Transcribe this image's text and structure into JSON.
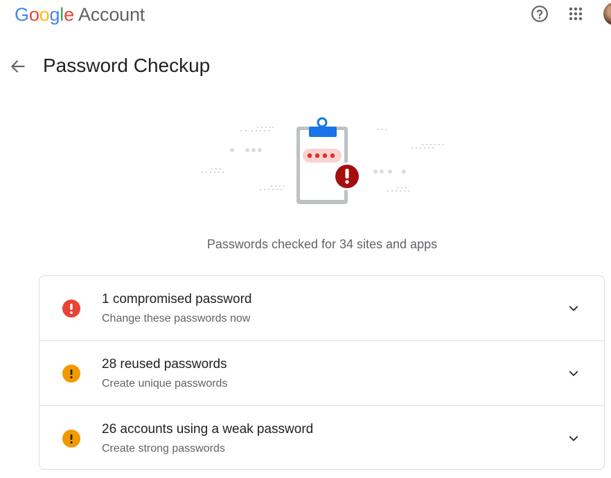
{
  "header": {
    "brand_letters": [
      "G",
      "o",
      "o",
      "g",
      "l",
      "e"
    ],
    "product": "Account",
    "icons": [
      "help-icon",
      "apps-icon",
      "avatar"
    ]
  },
  "page": {
    "title": "Password Checkup",
    "summary": "Passwords checked for 34 sites and apps"
  },
  "checks": [
    {
      "title": "1 compromised password",
      "subtitle": "Change these passwords now",
      "severity": "critical",
      "color": "#ea4335"
    },
    {
      "title": "28 reused passwords",
      "subtitle": "Create unique passwords",
      "severity": "warning",
      "color": "#f29900"
    },
    {
      "title": "26 accounts using a weak password",
      "subtitle": "Create strong passwords",
      "severity": "warning",
      "color": "#f29900"
    }
  ],
  "colors": {
    "blue": "#1a73e8",
    "red": "#d93025",
    "dark_red": "#a50e0e",
    "grey_text": "#5f6368"
  }
}
